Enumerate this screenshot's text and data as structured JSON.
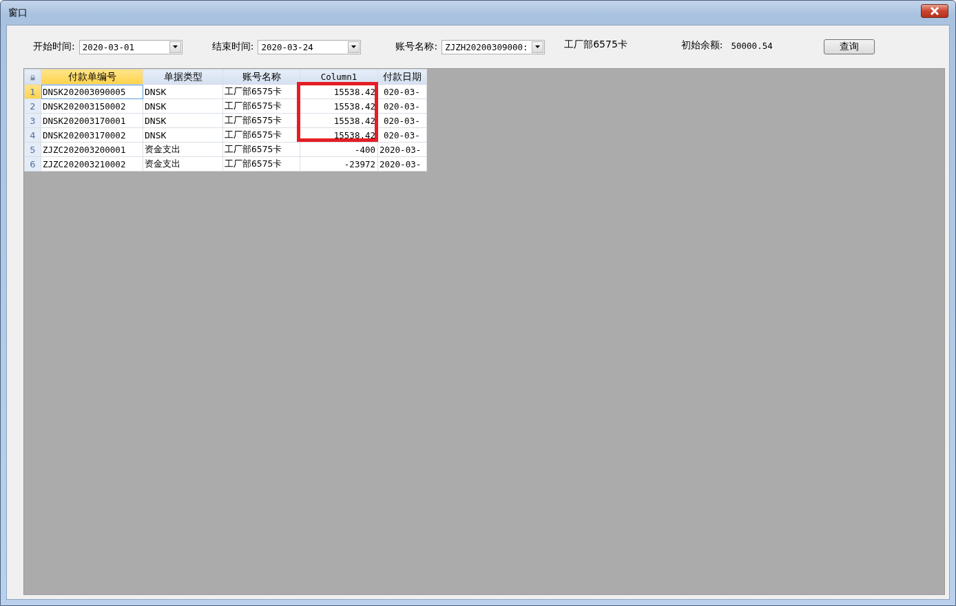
{
  "window": {
    "title": "窗口"
  },
  "filters": [
    {
      "kind": "date",
      "label": "开始时间:",
      "value": "2020-03-01"
    },
    {
      "kind": "date",
      "label": "结束时间:",
      "value": "2020-03-24"
    },
    {
      "kind": "combo",
      "label": "账号名称:",
      "value": "ZJZH20200309000:"
    },
    {
      "kind": "text",
      "value": "工厂部6575卡"
    },
    {
      "kind": "text",
      "label": "初始余额:",
      "value": "50000.54"
    }
  ],
  "query_button": "查询",
  "table": {
    "columns": [
      {
        "label": "付款单编号",
        "selected": true
      },
      {
        "label": "单据类型",
        "selected": false
      },
      {
        "label": "账号名称",
        "selected": false
      },
      {
        "label": "Column1",
        "selected": false
      },
      {
        "label": "付款日期",
        "selected": false
      }
    ],
    "rows": [
      {
        "number": "1",
        "selected": true,
        "highlighted": true,
        "cells": [
          "DNSK202003090005",
          "DNSK",
          "工厂部6575卡",
          "15538.42",
          "020-03-"
        ]
      },
      {
        "number": "2",
        "selected": false,
        "highlighted": true,
        "cells": [
          "DNSK202003150002",
          "DNSK",
          "工厂部6575卡",
          "15538.42",
          "020-03-"
        ]
      },
      {
        "number": "3",
        "selected": false,
        "highlighted": true,
        "cells": [
          "DNSK202003170001",
          "DNSK",
          "工厂部6575卡",
          "15538.42",
          "020-03-"
        ]
      },
      {
        "number": "4",
        "selected": false,
        "highlighted": true,
        "cells": [
          "DNSK202003170002",
          "DNSK",
          "工厂部6575卡",
          "15538.42",
          "020-03-"
        ]
      },
      {
        "number": "5",
        "selected": false,
        "highlighted": false,
        "cells": [
          "ZJZC202003200001",
          "资金支出",
          "工厂部6575卡",
          "-400",
          "2020-03-"
        ]
      },
      {
        "number": "6",
        "selected": false,
        "highlighted": false,
        "cells": [
          "ZJZC202003210002",
          "资金支出",
          "工厂部6575卡",
          "-23972",
          "2020-03-"
        ]
      }
    ]
  }
}
